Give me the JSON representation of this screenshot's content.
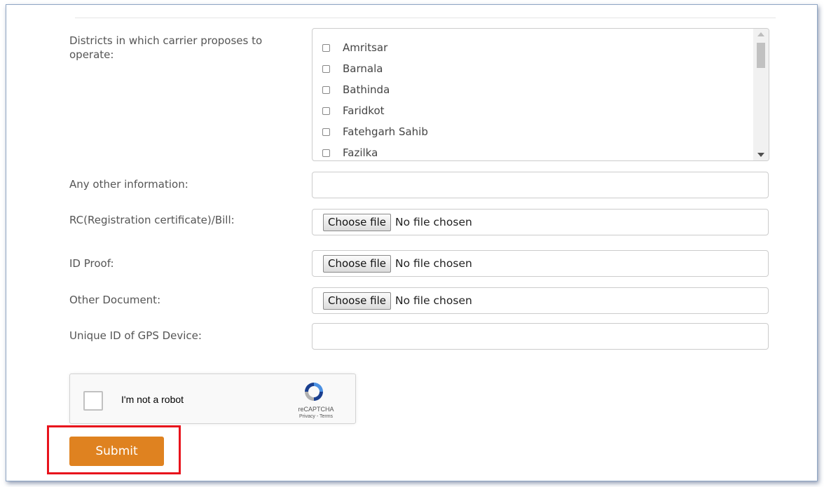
{
  "form": {
    "districts_label": "Districts in which carrier proposes to operate:",
    "districts": [
      {
        "name": "Amritsar",
        "checked": false
      },
      {
        "name": "Barnala",
        "checked": false
      },
      {
        "name": "Bathinda",
        "checked": false
      },
      {
        "name": "Faridkot",
        "checked": false
      },
      {
        "name": "Fatehgarh Sahib",
        "checked": false
      },
      {
        "name": "Fazilka",
        "checked": false
      }
    ],
    "other_info_label": "Any other information:",
    "other_info_value": "",
    "rc_label": "RC(Registration certificate)/Bill:",
    "id_proof_label": "ID Proof:",
    "other_doc_label": "Other Document:",
    "gps_label": "Unique ID of GPS Device:",
    "gps_value": "",
    "file_inputs": {
      "button_label": "Choose file",
      "status": "No file chosen"
    }
  },
  "captcha": {
    "label": "I'm not a robot",
    "brand": "reCAPTCHA",
    "links": "Privacy - Terms"
  },
  "submit": {
    "label": "Submit"
  },
  "colors": {
    "submit_bg": "#df8220",
    "highlight_border": "#e8131c",
    "frame_border": "#8fa6c4"
  },
  "icons": {
    "captcha_logo": "recaptcha-logo-icon",
    "scroll_up": "scroll-up-arrow-icon",
    "scroll_down": "scroll-down-arrow-icon"
  }
}
